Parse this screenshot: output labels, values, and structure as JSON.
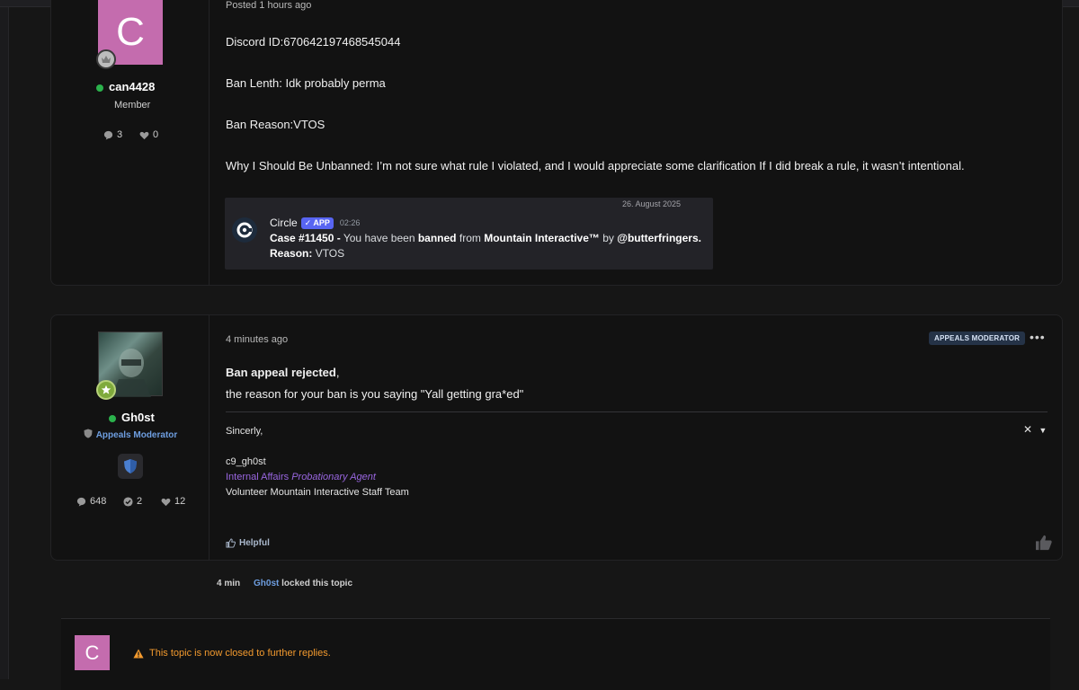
{
  "post1": {
    "author": {
      "initial": "C",
      "username": "can4428",
      "role": "Member",
      "posts": "3",
      "likes": "0"
    },
    "timestamp_partial": "Posted 1 hours ago",
    "lines": {
      "discord": "Discord ID:670642197468545044",
      "ban_length": "Ban Lenth: Idk probably perma",
      "ban_reason": "Ban Reason:VTOS",
      "why": "Why I Should Be Unbanned: I’m not sure what rule I violated, and I would appreciate some clarification If I did break a rule, it wasn’t intentional."
    },
    "embed": {
      "date": "26. August 2025",
      "bot_name": "Circle",
      "bot_tag": "APP",
      "time": "02:26",
      "case_label": "Case #11450 -",
      "case_pre": "You have been",
      "case_banned": "banned",
      "case_from": "from",
      "case_server": "Mountain Interactive™",
      "case_by": "by",
      "case_user": "@butterfringers.",
      "reason_label": "Reason:",
      "reason_value": "VTOS"
    }
  },
  "post2": {
    "author": {
      "username": "Gh0st",
      "role": "Appeals Moderator",
      "posts": "648",
      "solutions": "2",
      "likes": "12"
    },
    "timestamp": "4 minutes ago",
    "tag": "APPEALS MODERATOR",
    "more": "•••",
    "body_bold": "Ban appeal rejected",
    "body_comma": ",",
    "body_line2": "the reason for your ban is you saying \"Yall getting gra*ed\"",
    "signature": {
      "greeting": "Sincerly,",
      "name": "c9_gh0st",
      "title_plain": "Internal Affairs",
      "title_italic": "Probationary Agent",
      "team": "Volunteer Mountain Interactive Staff Team"
    },
    "helpful": "Helpful"
  },
  "event": {
    "time": "4 min",
    "user": "Gh0st",
    "action": "locked this topic"
  },
  "closed": {
    "initial": "C",
    "message": "This topic is now closed to further replies."
  },
  "colors": {
    "background": "#161616",
    "card": "#121212",
    "avatar_pink": "#c46cae",
    "accent_blue": "#6e9ee0",
    "warning_orange": "#f39a2e",
    "discord_app": "#5865f2"
  }
}
